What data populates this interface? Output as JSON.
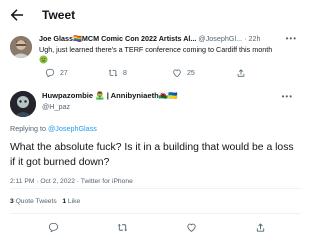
{
  "header": {
    "title": "Tweet"
  },
  "parent_tweet": {
    "display_name": "Joe Glass🏳️‍🌈MCM Comic Con 2022 Artists Al...",
    "handle": "@JosephGl...",
    "separator": "·",
    "time": "22h",
    "text": "Ugh, just learned there's a TERF conference coming to Cardiff this month",
    "actions": {
      "replies": "27",
      "retweets": "8",
      "likes": "25"
    }
  },
  "main_tweet": {
    "display_name": "Huwpazombie 🧟‍♂️ | Annibyniaeth🏴󠁧󠁢󠁷󠁬󠁳󠁿🇺🇦",
    "handle": "@H_paz",
    "replying_prefix": "Replying to",
    "replying_to": "@JosephGlass",
    "text": "What the absolute fuck? Is it in a building that would be a loss if it got burned down?",
    "meta": "2:11 PM · Oct 2, 2022 · Twitter for iPhone",
    "quote_count": "3",
    "quote_label": "Quote Tweets",
    "like_count": "1",
    "like_label": "Like"
  },
  "colors": {
    "accent": "#1d9bf0",
    "secondary_text": "#536471",
    "primary_text": "#0f1419",
    "divider": "#eff3f4"
  }
}
